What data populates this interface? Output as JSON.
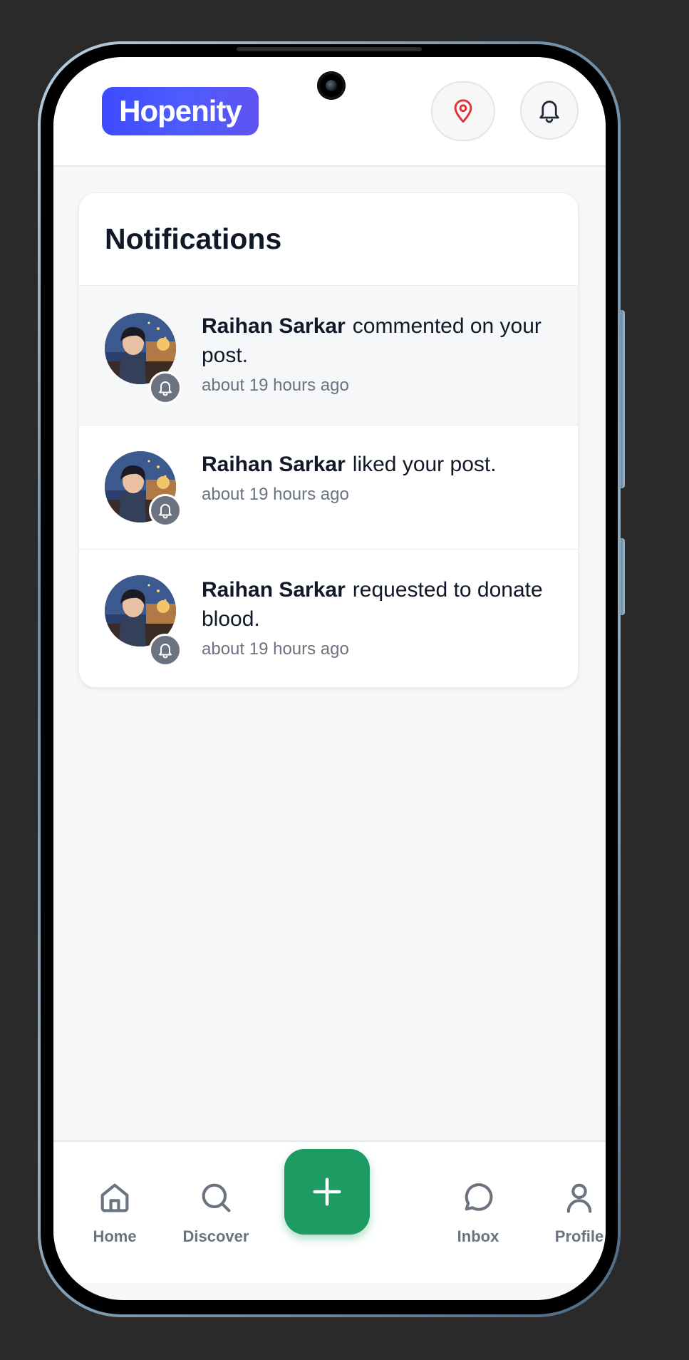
{
  "header": {
    "logo_text": "Hopenity",
    "location_icon": "map-pin-icon",
    "bell_icon": "bell-icon"
  },
  "notifications": {
    "title": "Notifications",
    "items": [
      {
        "name": "Raihan Sarkar",
        "action": "commented on your post.",
        "time": "about 19 hours ago",
        "unread": true
      },
      {
        "name": "Raihan Sarkar",
        "action": "liked your post.",
        "time": "about 19 hours ago",
        "unread": false
      },
      {
        "name": "Raihan Sarkar",
        "action": "requested to donate blood.",
        "time": "about 19 hours ago",
        "unread": false
      }
    ]
  },
  "nav": {
    "home": "Home",
    "discover": "Discover",
    "inbox": "Inbox",
    "profile": "Profile",
    "add_icon": "plus-icon"
  },
  "colors": {
    "brand": "#3d4bff",
    "fab": "#1e9a63",
    "pin": "#e0313b"
  }
}
